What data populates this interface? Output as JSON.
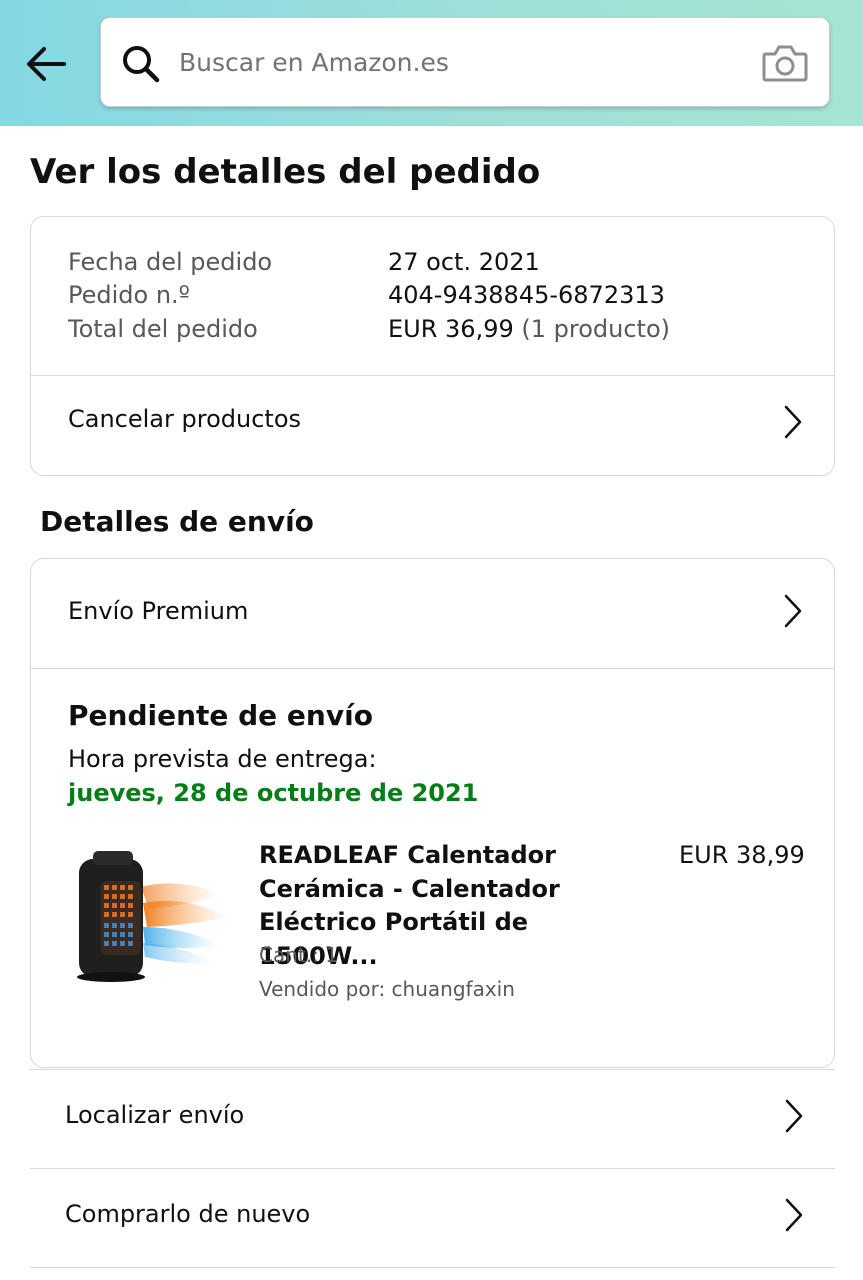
{
  "header": {
    "back_icon": "back-arrow-icon",
    "search": {
      "placeholder": "Buscar en Amazon.es",
      "value": ""
    },
    "search_icon": "search-icon",
    "camera_icon": "camera-icon",
    "gradient_colors": [
      "#84d8e3",
      "#a6e4d3"
    ]
  },
  "page_title": "Ver los detalles del pedido",
  "summary": {
    "rows": [
      {
        "label": "Fecha del pedido",
        "value": "27 oct. 2021",
        "sub": ""
      },
      {
        "label": "Pedido n.º",
        "value": "404-9438845-6872313",
        "sub": ""
      },
      {
        "label": "Total del pedido",
        "value": "EUR 36,99",
        "sub": "(1 producto)"
      }
    ],
    "action_label": "Cancelar productos"
  },
  "shipping": {
    "section_title": "Detalles de envío",
    "method_label": "Envío Premium",
    "status": "Pendiente de envío",
    "eta_label": "Hora prevista de entrega:",
    "eta_date": "jueves, 28 de octubre de 2021",
    "eta_color": "#067d17",
    "product": {
      "title": "READLEAF Calentador Cerámica - Calentador Eléctrico Portátil de 1500W...",
      "price": "EUR 38,99",
      "quantity": "Cant.: 1",
      "seller": "Vendido por: chuangfaxin"
    }
  },
  "actions": [
    {
      "label": "Localizar envío"
    },
    {
      "label": "Comprarlo de nuevo"
    }
  ]
}
